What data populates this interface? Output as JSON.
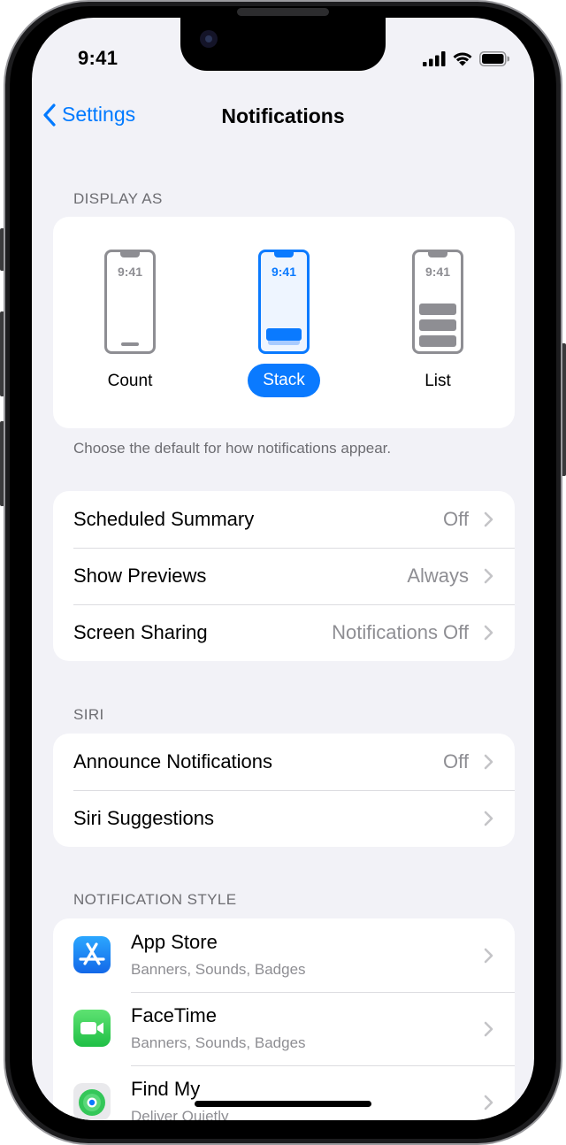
{
  "status": {
    "time": "9:41"
  },
  "nav": {
    "back_label": "Settings",
    "title": "Notifications"
  },
  "display_as": {
    "header": "DISPLAY AS",
    "options": [
      {
        "label": "Count",
        "mini_time": "9:41",
        "selected": false
      },
      {
        "label": "Stack",
        "mini_time": "9:41",
        "selected": true
      },
      {
        "label": "List",
        "mini_time": "9:41",
        "selected": false
      }
    ],
    "footnote": "Choose the default for how notifications appear."
  },
  "general": {
    "rows": [
      {
        "label": "Scheduled Summary",
        "value": "Off"
      },
      {
        "label": "Show Previews",
        "value": "Always"
      },
      {
        "label": "Screen Sharing",
        "value": "Notifications Off"
      }
    ]
  },
  "siri": {
    "header": "SIRI",
    "rows": [
      {
        "label": "Announce Notifications",
        "value": "Off"
      },
      {
        "label": "Siri Suggestions",
        "value": ""
      }
    ]
  },
  "notification_style": {
    "header": "NOTIFICATION STYLE",
    "apps": [
      {
        "name": "App Store",
        "subtitle": "Banners, Sounds, Badges",
        "icon": "app-store-icon",
        "color": "#1a8cff"
      },
      {
        "name": "FaceTime",
        "subtitle": "Banners, Sounds, Badges",
        "icon": "facetime-icon",
        "color": "#31c75a"
      },
      {
        "name": "Find My",
        "subtitle": "Deliver Quietly",
        "icon": "find-my-icon",
        "color": "#34c759"
      }
    ]
  },
  "colors": {
    "accent": "#007aff",
    "background": "#f2f2f7",
    "secondary_text": "#8e8e93"
  }
}
